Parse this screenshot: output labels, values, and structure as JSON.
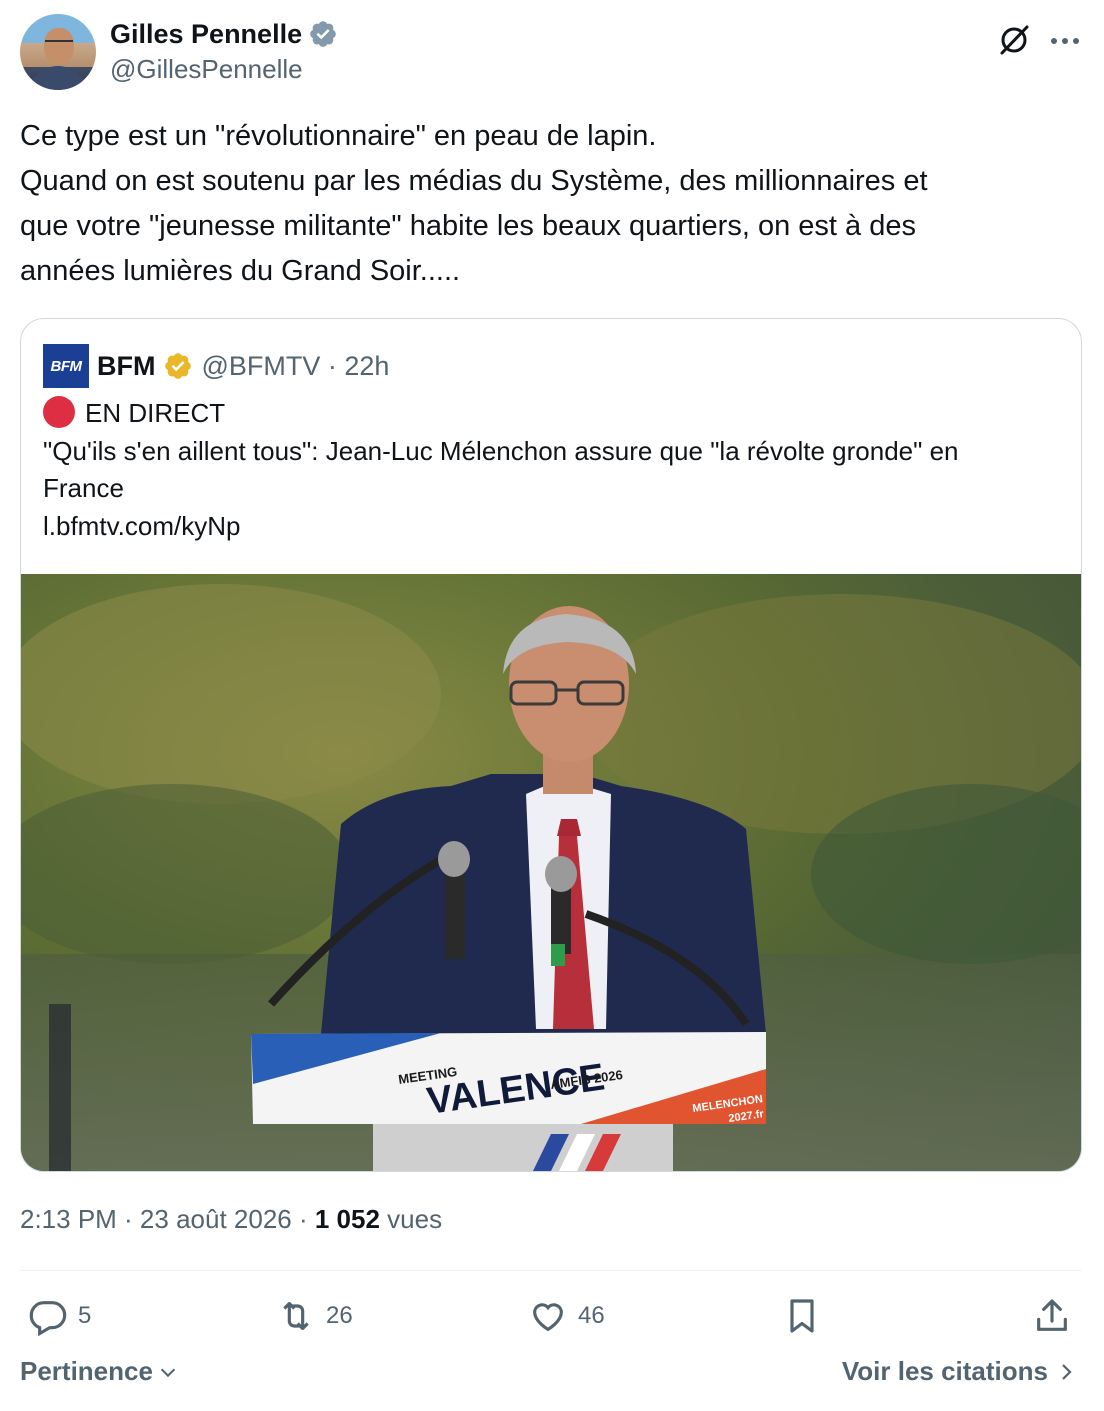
{
  "author": {
    "name": "Gilles Pennelle",
    "handle": "@GillesPennelle"
  },
  "tweet": {
    "lines": [
      "Ce type est un \"révolutionnaire\" en peau de lapin.",
      "Quand on est soutenu par les médias du Système, des millionnaires et",
      "que votre \"jeunesse militante\" habite les beaux quartiers, on est à des",
      "années lumières du Grand Soir....."
    ]
  },
  "quote": {
    "logo_text": "BFM",
    "name": "BFM",
    "handle_time": "@BFMTV · 22h",
    "live_label": "EN DIRECT",
    "text_lines": [
      "\"Qu'ils s'en aillent tous\": Jean-Luc Mélenchon assure que \"la révolte gronde\" en",
      "France"
    ],
    "link": "l.bfmtv.com/kyNp",
    "podium": {
      "small_left": "MEETING",
      "big": "VALENCE",
      "small_right": "AMFIS 2026",
      "corner_line1": "MELENCHON",
      "corner_line2": "2027.fr"
    }
  },
  "meta": {
    "time_date": "2:13 PM · 23 août 2026 · ",
    "views_count": "1 052",
    "views_label": " vues"
  },
  "actions": {
    "replies": "5",
    "reposts": "26",
    "likes": "46"
  },
  "footer": {
    "sort_label": "Pertinence",
    "quotes_label": "Voir les citations"
  },
  "colors": {
    "verified_blue": "#829aab",
    "verified_gold": "#e8b829",
    "bfm_blue": "#1b3f94",
    "live_red": "#dd2e44",
    "secondary_text": "#536471"
  }
}
